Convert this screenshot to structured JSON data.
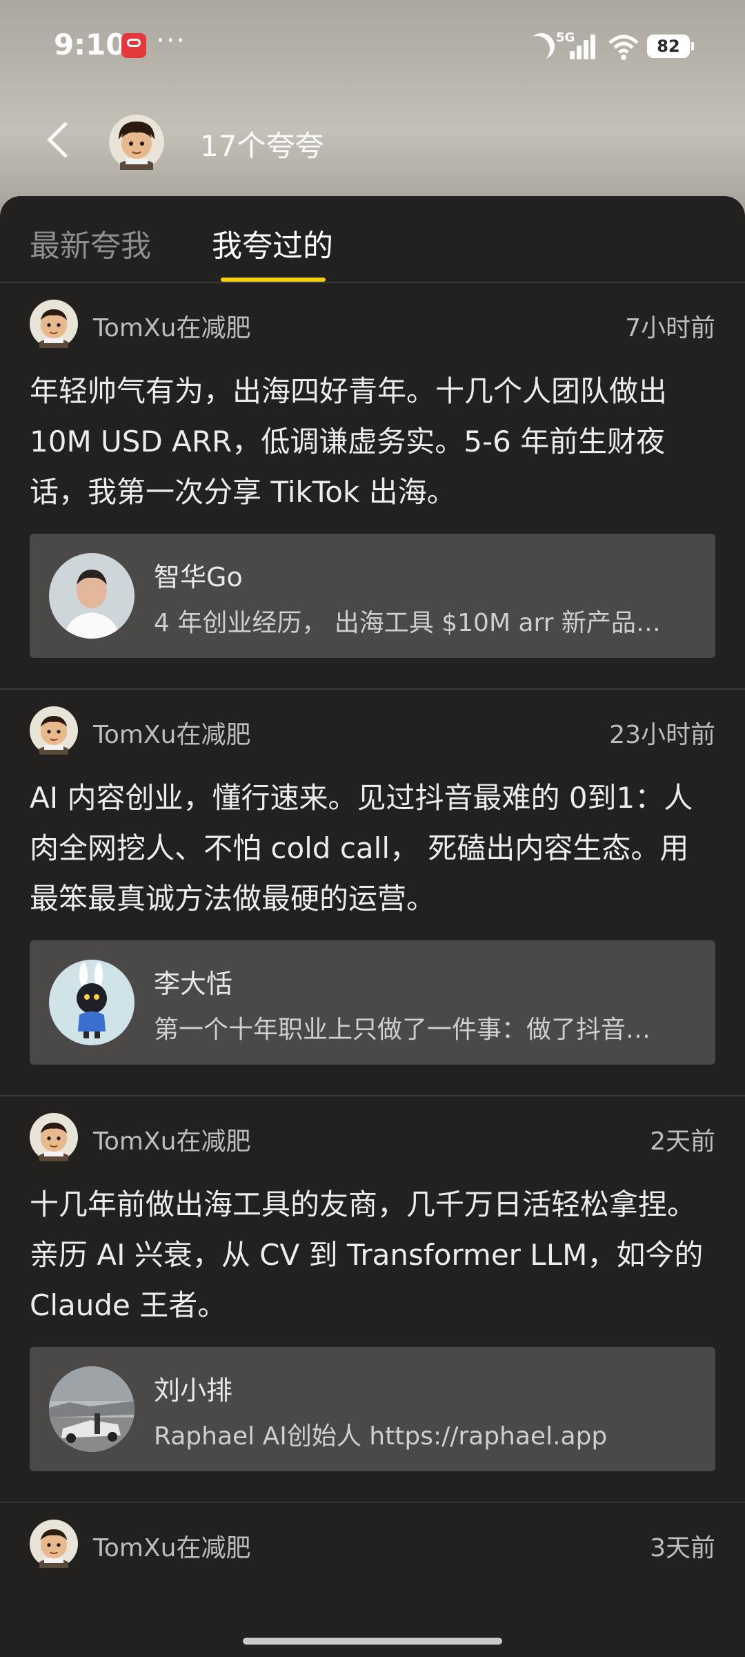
{
  "status_bar": {
    "time": "9:10",
    "dots": "···",
    "network": "5G",
    "battery": "82"
  },
  "header": {
    "title": "17个夸夸"
  },
  "tabs": [
    {
      "label": "最新夸我"
    },
    {
      "label": "我夸过的"
    }
  ],
  "feed": [
    {
      "author": "TomXu在减肥",
      "time": "7小时前",
      "text": "年轻帅气有为，出海四好青年。十几个人团队做出 10M USD ARR，低调谦虚务实。5-6 年前生财夜话，我第一次分享 TikTok 出海。",
      "profile": {
        "name": "智华Go",
        "desc": "4 年创业经历， 出海工具 $10M arr 新产品…"
      }
    },
    {
      "author": "TomXu在减肥",
      "time": "23小时前",
      "text": "AI 内容创业，懂行速来。见过抖音最难的 0到1：人肉全网挖人、不怕 cold call， 死磕出内容生态。用最笨最真诚方法做最硬的运营。",
      "profile": {
        "name": "李大恬",
        "desc": "第一个十年职业上只做了一件事：做了抖音…"
      }
    },
    {
      "author": "TomXu在减肥",
      "time": "2天前",
      "text": "十几年前做出海工具的友商，几千万日活轻松拿捏。亲历 AI 兴衰，从 CV 到 Transformer LLM，如今的 Claude 王者。",
      "profile": {
        "name": "刘小排",
        "desc": "Raphael AI创始人 https://raphael.app"
      }
    },
    {
      "author": "TomXu在减肥",
      "time": "3天前"
    }
  ],
  "colors": {
    "accent": "#f5d10d",
    "panel_bg": "#222120",
    "card_bg": "#4a4948"
  }
}
